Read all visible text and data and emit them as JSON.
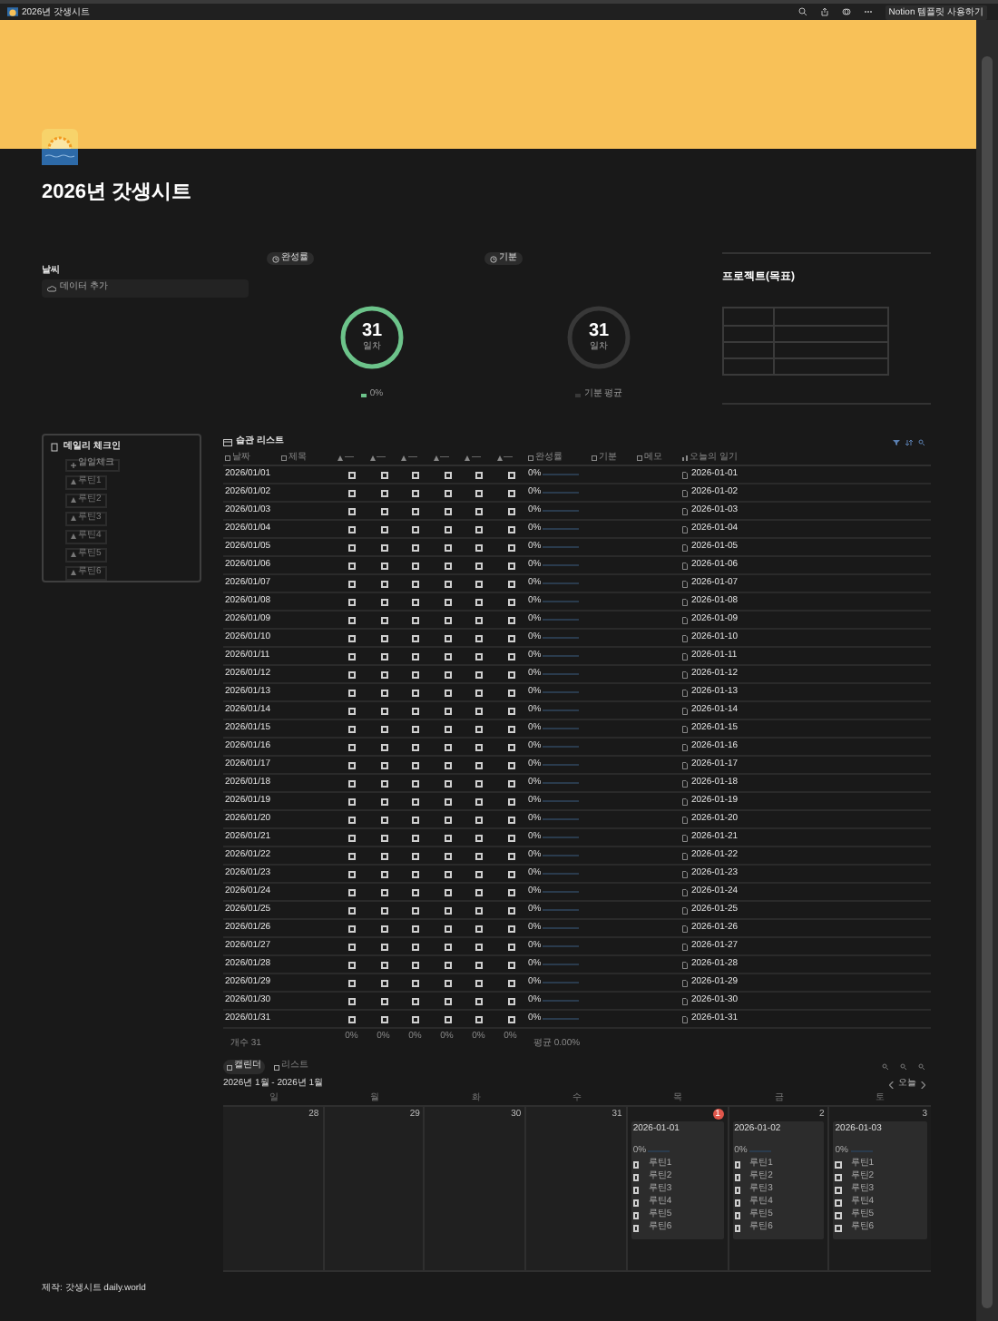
{
  "topbar": {
    "breadcrumb": "2026년 갓생시트",
    "button": "Notion 템플릿 사용하기"
  },
  "title": "2026년 갓생시트",
  "weather": {
    "label": "날씨",
    "button": "데이터 추가"
  },
  "rings": [
    {
      "badge": "완성률",
      "value": "31",
      "unit": "일차",
      "legend": "0%",
      "color": "#6cc38a"
    },
    {
      "badge": "기분",
      "value": "31",
      "unit": "일차",
      "legend": "기분 평균",
      "color": "#383838"
    }
  ],
  "project": {
    "title": "프로젝트(목표)"
  },
  "checkin": {
    "title": "데일리 체크인",
    "add": "일일체크",
    "buttons": [
      "루틴1",
      "루틴2",
      "루틴3",
      "루틴4",
      "루틴5",
      "루틴6"
    ]
  },
  "habits": {
    "title": "습관 리스트",
    "columns": [
      {
        "label": "날짜",
        "kind": "date"
      },
      {
        "label": "제목",
        "kind": "title"
      },
      {
        "label": "—",
        "kind": "check"
      },
      {
        "label": "—",
        "kind": "check"
      },
      {
        "label": "—",
        "kind": "check"
      },
      {
        "label": "—",
        "kind": "check"
      },
      {
        "label": "—",
        "kind": "check"
      },
      {
        "label": "—",
        "kind": "check"
      },
      {
        "label": "완성률",
        "kind": "progress"
      },
      {
        "label": "기분",
        "kind": "mood"
      },
      {
        "label": "메모",
        "kind": "memo"
      },
      {
        "label": "오늘의 일기",
        "kind": "due"
      }
    ],
    "rows": [
      {
        "date": "2026/01/01",
        "checks": [
          false,
          false,
          false,
          false,
          false,
          false
        ],
        "progress": "0%",
        "due": "2026-01-01"
      },
      {
        "date": "2026/01/02",
        "checks": [
          false,
          false,
          false,
          false,
          false,
          false
        ],
        "progress": "0%",
        "due": "2026-01-02"
      },
      {
        "date": "2026/01/03",
        "checks": [
          false,
          false,
          false,
          false,
          false,
          false
        ],
        "progress": "0%",
        "due": "2026-01-03"
      },
      {
        "date": "2026/01/04",
        "checks": [
          false,
          false,
          false,
          false,
          false,
          false
        ],
        "progress": "0%",
        "due": "2026-01-04"
      },
      {
        "date": "2026/01/05",
        "checks": [
          false,
          false,
          false,
          false,
          false,
          false
        ],
        "progress": "0%",
        "due": "2026-01-05"
      },
      {
        "date": "2026/01/06",
        "checks": [
          false,
          false,
          false,
          false,
          false,
          false
        ],
        "progress": "0%",
        "due": "2026-01-06"
      },
      {
        "date": "2026/01/07",
        "checks": [
          false,
          false,
          false,
          false,
          false,
          false
        ],
        "progress": "0%",
        "due": "2026-01-07"
      },
      {
        "date": "2026/01/08",
        "checks": [
          false,
          false,
          false,
          false,
          false,
          false
        ],
        "progress": "0%",
        "due": "2026-01-08"
      },
      {
        "date": "2026/01/09",
        "checks": [
          false,
          false,
          false,
          false,
          false,
          false
        ],
        "progress": "0%",
        "due": "2026-01-09"
      },
      {
        "date": "2026/01/10",
        "checks": [
          false,
          false,
          false,
          false,
          false,
          false
        ],
        "progress": "0%",
        "due": "2026-01-10"
      },
      {
        "date": "2026/01/11",
        "checks": [
          false,
          false,
          false,
          false,
          false,
          false
        ],
        "progress": "0%",
        "due": "2026-01-11"
      },
      {
        "date": "2026/01/12",
        "checks": [
          false,
          false,
          false,
          false,
          false,
          false
        ],
        "progress": "0%",
        "due": "2026-01-12"
      },
      {
        "date": "2026/01/13",
        "checks": [
          false,
          false,
          false,
          false,
          false,
          false
        ],
        "progress": "0%",
        "due": "2026-01-13"
      },
      {
        "date": "2026/01/14",
        "checks": [
          false,
          false,
          false,
          false,
          false,
          false
        ],
        "progress": "0%",
        "due": "2026-01-14"
      },
      {
        "date": "2026/01/15",
        "checks": [
          false,
          false,
          false,
          false,
          false,
          false
        ],
        "progress": "0%",
        "due": "2026-01-15"
      },
      {
        "date": "2026/01/16",
        "checks": [
          false,
          false,
          false,
          false,
          false,
          false
        ],
        "progress": "0%",
        "due": "2026-01-16"
      },
      {
        "date": "2026/01/17",
        "checks": [
          false,
          false,
          false,
          false,
          false,
          false
        ],
        "progress": "0%",
        "due": "2026-01-17"
      },
      {
        "date": "2026/01/18",
        "checks": [
          false,
          false,
          false,
          false,
          false,
          false
        ],
        "progress": "0%",
        "due": "2026-01-18"
      },
      {
        "date": "2026/01/19",
        "checks": [
          false,
          false,
          false,
          false,
          false,
          false
        ],
        "progress": "0%",
        "due": "2026-01-19"
      },
      {
        "date": "2026/01/20",
        "checks": [
          false,
          false,
          false,
          false,
          false,
          false
        ],
        "progress": "0%",
        "due": "2026-01-20"
      },
      {
        "date": "2026/01/21",
        "checks": [
          false,
          false,
          false,
          false,
          false,
          false
        ],
        "progress": "0%",
        "due": "2026-01-21"
      },
      {
        "date": "2026/01/22",
        "checks": [
          false,
          false,
          false,
          false,
          false,
          false
        ],
        "progress": "0%",
        "due": "2026-01-22"
      },
      {
        "date": "2026/01/23",
        "checks": [
          false,
          false,
          false,
          false,
          false,
          false
        ],
        "progress": "0%",
        "due": "2026-01-23"
      },
      {
        "date": "2026/01/24",
        "checks": [
          false,
          false,
          false,
          false,
          false,
          false
        ],
        "progress": "0%",
        "due": "2026-01-24"
      },
      {
        "date": "2026/01/25",
        "checks": [
          false,
          false,
          false,
          false,
          false,
          false
        ],
        "progress": "0%",
        "due": "2026-01-25"
      },
      {
        "date": "2026/01/26",
        "checks": [
          false,
          false,
          false,
          false,
          false,
          false
        ],
        "progress": "0%",
        "due": "2026-01-26"
      },
      {
        "date": "2026/01/27",
        "checks": [
          false,
          false,
          false,
          false,
          false,
          false
        ],
        "progress": "0%",
        "due": "2026-01-27"
      },
      {
        "date": "2026/01/28",
        "checks": [
          false,
          false,
          false,
          false,
          false,
          false
        ],
        "progress": "0%",
        "due": "2026-01-28"
      },
      {
        "date": "2026/01/29",
        "checks": [
          false,
          false,
          false,
          false,
          false,
          false
        ],
        "progress": "0%",
        "due": "2026-01-29"
      },
      {
        "date": "2026/01/30",
        "checks": [
          false,
          false,
          false,
          false,
          false,
          false
        ],
        "progress": "0%",
        "due": "2026-01-30"
      },
      {
        "date": "2026/01/31",
        "checks": [
          false,
          false,
          false,
          false,
          false,
          false
        ],
        "progress": "0%",
        "due": "2026-01-31"
      }
    ],
    "footer": {
      "count": "개수 31",
      "totals": [
        "0%",
        "0%",
        "0%",
        "0%",
        "0%",
        "0%"
      ],
      "average": "평균 0.00%"
    }
  },
  "calendar": {
    "tabs": [
      {
        "label": "캘린더",
        "selected": true
      },
      {
        "label": "리스트",
        "selected": false
      }
    ],
    "range": "2026년 1월 - 2026년 1월",
    "today_button": "오늘",
    "weekdays": [
      "일",
      "월",
      "화",
      "수",
      "목",
      "금",
      "토"
    ],
    "days": [
      {
        "day": "28",
        "today": false
      },
      {
        "day": "29",
        "today": false
      },
      {
        "day": "30",
        "today": false
      },
      {
        "day": "31",
        "today": false
      },
      {
        "day": "1",
        "today": true,
        "card": {
          "date": "2026-01-01",
          "progress": "0%",
          "items": [
            {
              "label": "루틴1",
              "checked": false
            },
            {
              "label": "루틴2",
              "checked": false
            },
            {
              "label": "루틴3",
              "checked": false
            },
            {
              "label": "루틴4",
              "checked": false
            },
            {
              "label": "루틴5",
              "checked": false
            },
            {
              "label": "루틴6",
              "checked": false
            }
          ]
        }
      },
      {
        "day": "2",
        "today": false,
        "card": {
          "date": "2026-01-02",
          "progress": "0%",
          "items": [
            {
              "label": "루틴1",
              "checked": false
            },
            {
              "label": "루틴2",
              "checked": false
            },
            {
              "label": "루틴3",
              "checked": false
            },
            {
              "label": "루틴4",
              "checked": false
            },
            {
              "label": "루틴5",
              "checked": false
            },
            {
              "label": "루틴6",
              "checked": false
            }
          ]
        }
      },
      {
        "day": "3",
        "today": false,
        "card": {
          "date": "2026-01-03",
          "progress": "0%",
          "items": [
            {
              "label": "루틴1",
              "checked": false
            },
            {
              "label": "루틴2",
              "checked": false
            },
            {
              "label": "루틴3",
              "checked": false
            },
            {
              "label": "루틴4",
              "checked": false
            },
            {
              "label": "루틴5",
              "checked": false
            },
            {
              "label": "루틴6",
              "checked": false
            }
          ]
        }
      }
    ]
  },
  "credit": "제작: 갓생시트 daily.world"
}
